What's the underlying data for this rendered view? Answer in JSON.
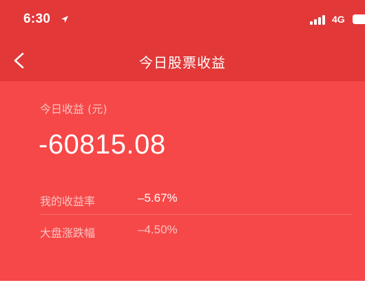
{
  "status_bar": {
    "time": "6:30",
    "network": "4G",
    "icons": [
      "location-icon",
      "signal-icon",
      "battery-icon"
    ]
  },
  "nav": {
    "title": "今日股票收益",
    "back_icon": "chevron-left-icon"
  },
  "summary": {
    "earnings_label": "今日收益 (元)",
    "earnings_value": "-60815.08",
    "rows": [
      {
        "label": "我的收益率",
        "value": "–5.67%"
      },
      {
        "label": "大盘涨跌幅",
        "value": "–4.50%"
      }
    ]
  },
  "colors": {
    "header_bg": "#e23838",
    "summary_bg": "#f64848",
    "text_primary": "#ffffff",
    "text_muted": "#fbc2c2"
  }
}
